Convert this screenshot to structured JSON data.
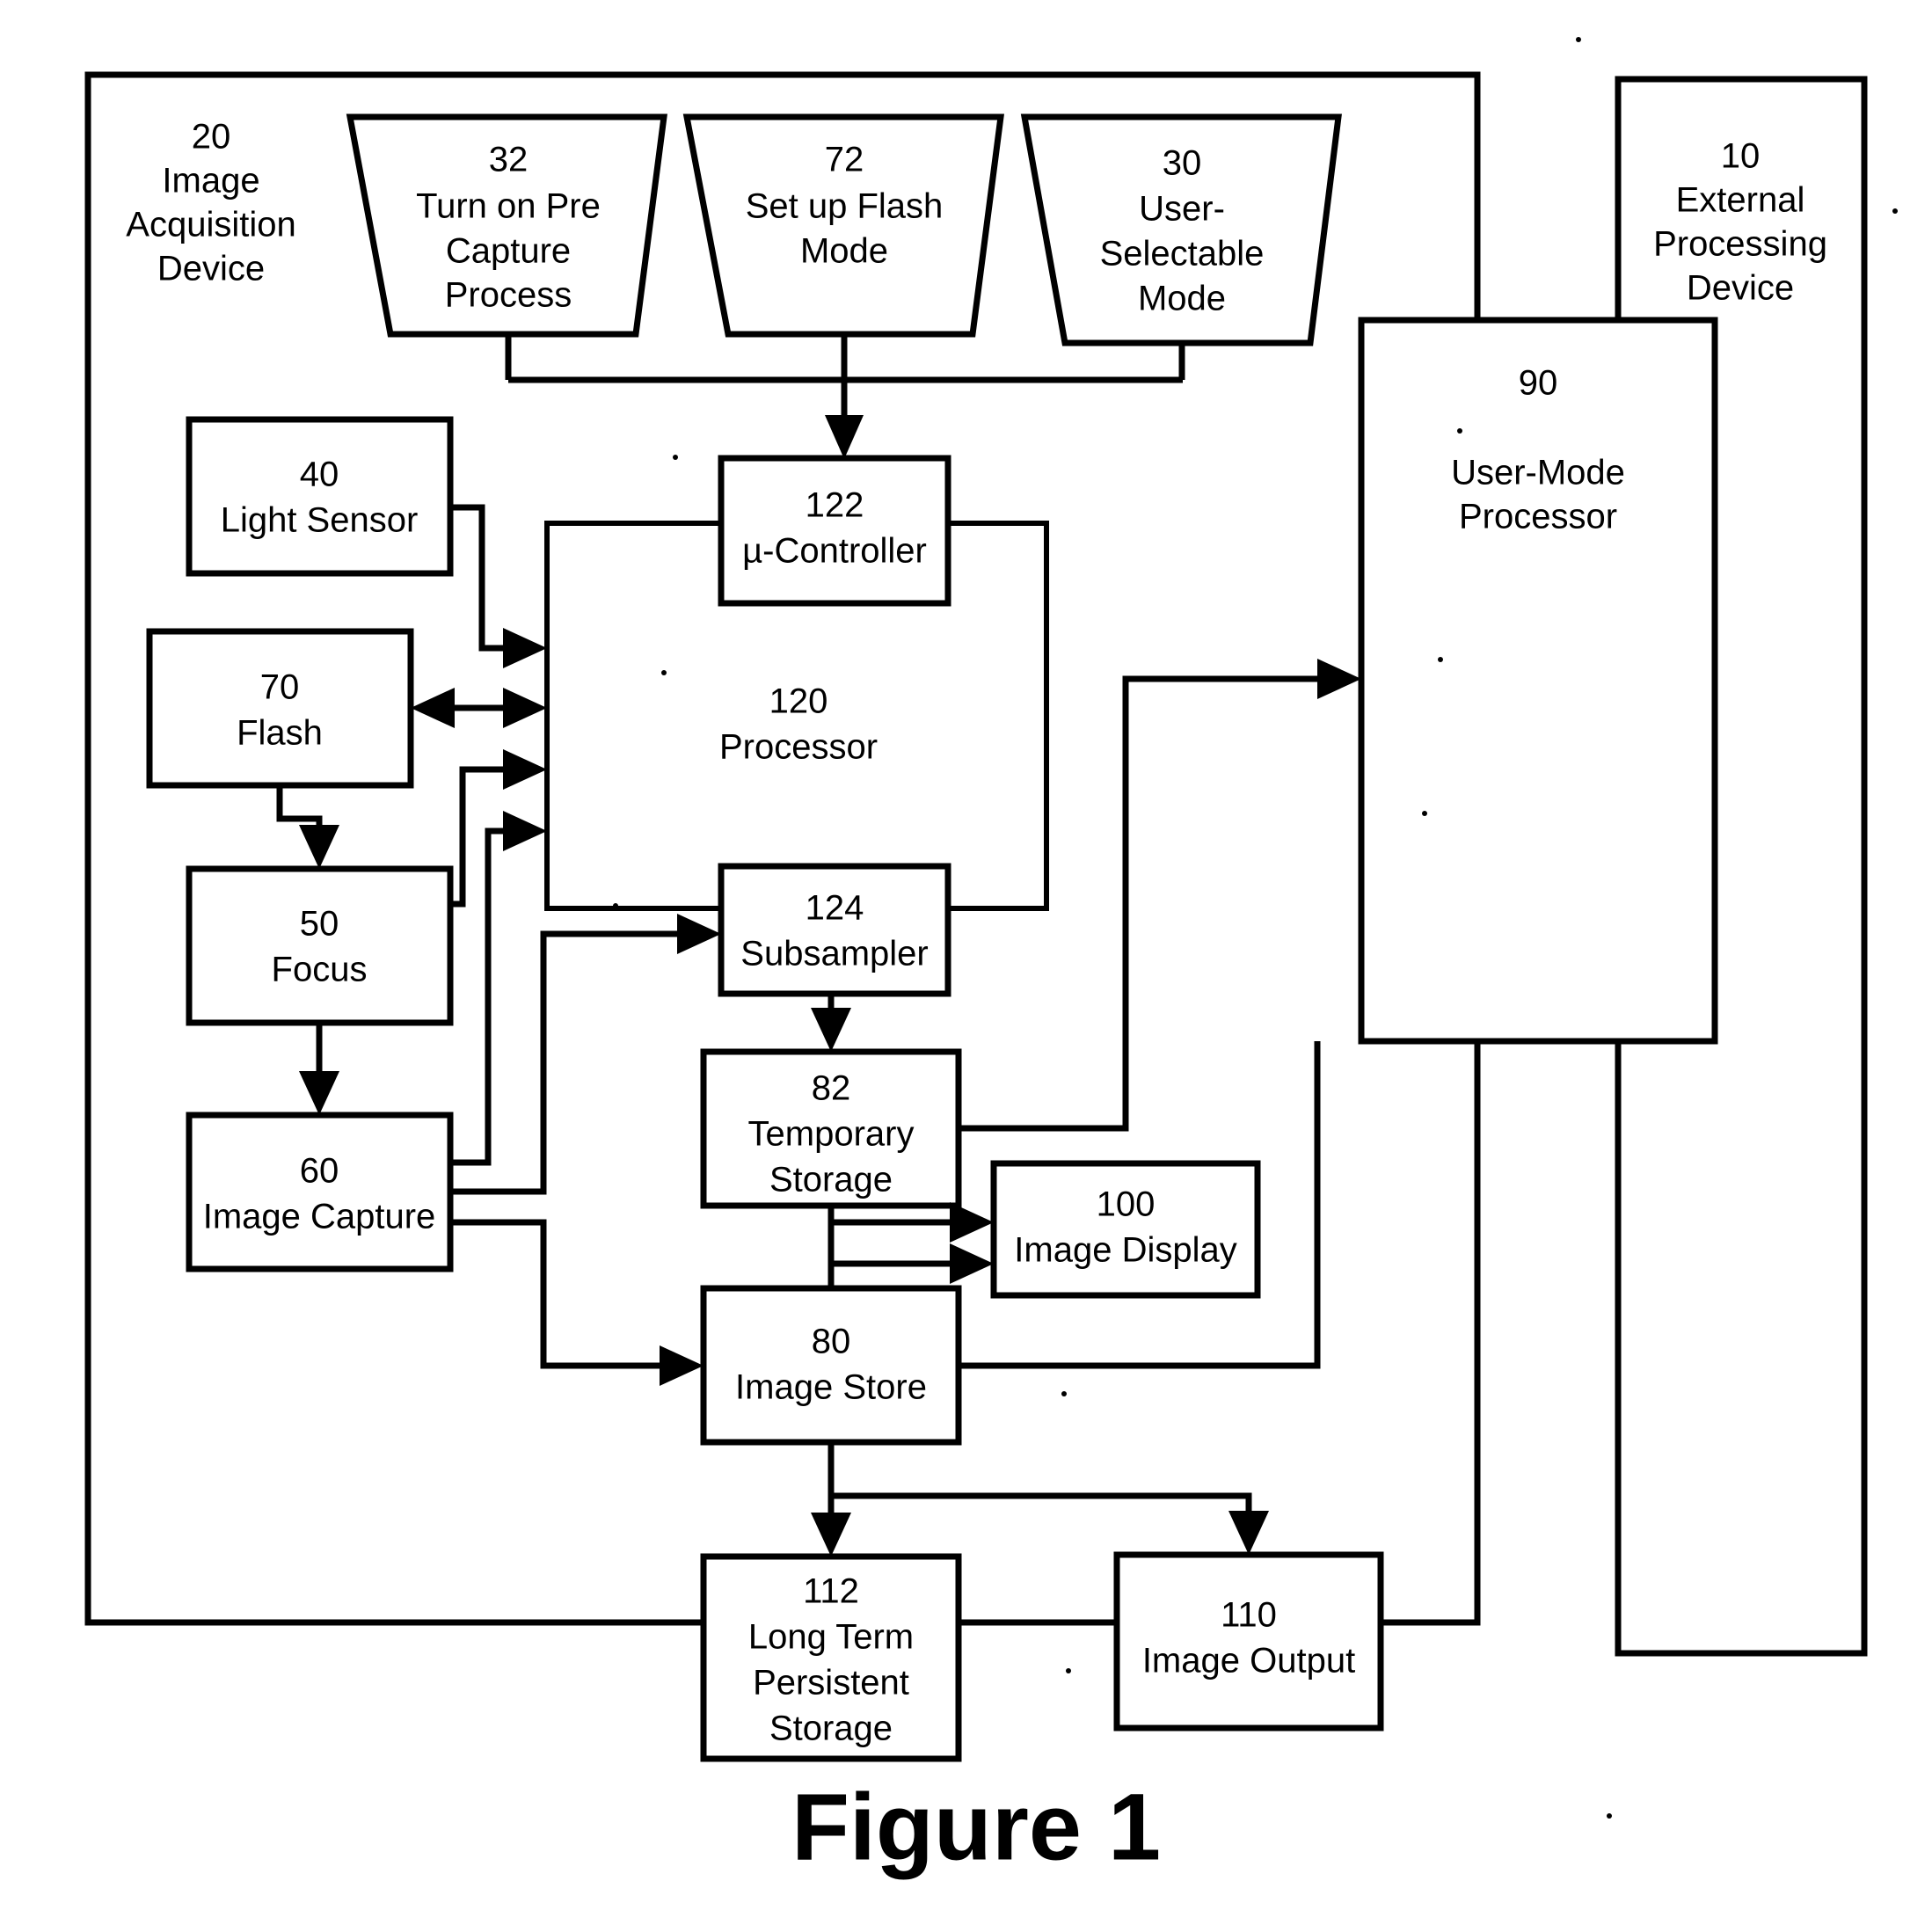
{
  "figure": {
    "caption": "Figure 1"
  },
  "containers": [
    {
      "id": "image-acquisition-device",
      "ref": "20",
      "name": "Image Acquisition Device",
      "lines": [
        "20",
        "Image",
        "Acquisition",
        "Device"
      ]
    },
    {
      "id": "external-processing-device",
      "ref": "10",
      "name": "External Processing Device",
      "lines": [
        "10",
        "External",
        "Processing",
        "Device"
      ]
    }
  ],
  "trapezoids": [
    {
      "id": "turn-on-pre-capture-process",
      "ref": "32",
      "lines": [
        "32",
        "Turn on Pre",
        "Capture",
        "Process"
      ]
    },
    {
      "id": "set-up-flash-mode",
      "ref": "72",
      "lines": [
        "72",
        "Set up Flash",
        "Mode"
      ]
    },
    {
      "id": "user-selectable-mode",
      "ref": "30",
      "lines": [
        "30",
        "User-",
        "Selectable",
        "Mode"
      ]
    }
  ],
  "blocks": [
    {
      "id": "light-sensor",
      "ref": "40",
      "lines": [
        "40",
        "Light Sensor"
      ]
    },
    {
      "id": "flash",
      "ref": "70",
      "lines": [
        "70",
        "Flash"
      ]
    },
    {
      "id": "focus",
      "ref": "50",
      "lines": [
        "50",
        "Focus"
      ]
    },
    {
      "id": "image-capture",
      "ref": "60",
      "lines": [
        "60",
        "Image Capture"
      ]
    },
    {
      "id": "processor",
      "ref": "120",
      "lines": [
        "120",
        "Processor"
      ]
    },
    {
      "id": "micro-controller",
      "ref": "122",
      "lines": [
        "122",
        "µ-Controller"
      ]
    },
    {
      "id": "subsampler",
      "ref": "124",
      "lines": [
        "124",
        "Subsampler"
      ]
    },
    {
      "id": "temporary-storage",
      "ref": "82",
      "lines": [
        "82",
        "Temporary",
        "Storage"
      ]
    },
    {
      "id": "image-display",
      "ref": "100",
      "lines": [
        "100",
        "Image Display"
      ]
    },
    {
      "id": "image-store",
      "ref": "80",
      "lines": [
        "80",
        "Image Store"
      ]
    },
    {
      "id": "long-term-persistent-storage",
      "ref": "112",
      "lines": [
        "112",
        "Long Term",
        "Persistent",
        "Storage"
      ]
    },
    {
      "id": "image-output",
      "ref": "110",
      "lines": [
        "110",
        "Image Output"
      ]
    },
    {
      "id": "user-mode-processor",
      "ref": "90",
      "lines": [
        "90",
        "User-Mode",
        "Processor"
      ]
    }
  ],
  "chart_data": {
    "type": "diagram",
    "title": "Figure 1",
    "nodes": [
      {
        "ref": "20",
        "label": "Image Acquisition Device",
        "shape": "container"
      },
      {
        "ref": "10",
        "label": "External Processing Device",
        "shape": "container"
      },
      {
        "ref": "32",
        "label": "Turn on Pre Capture Process",
        "shape": "trapezoid"
      },
      {
        "ref": "72",
        "label": "Set up Flash Mode",
        "shape": "trapezoid"
      },
      {
        "ref": "30",
        "label": "User-Selectable Mode",
        "shape": "trapezoid"
      },
      {
        "ref": "40",
        "label": "Light Sensor",
        "shape": "rect"
      },
      {
        "ref": "70",
        "label": "Flash",
        "shape": "rect"
      },
      {
        "ref": "50",
        "label": "Focus",
        "shape": "rect"
      },
      {
        "ref": "60",
        "label": "Image Capture",
        "shape": "rect"
      },
      {
        "ref": "120",
        "label": "Processor",
        "shape": "rect"
      },
      {
        "ref": "122",
        "label": "µ-Controller",
        "shape": "rect"
      },
      {
        "ref": "124",
        "label": "Subsampler",
        "shape": "rect"
      },
      {
        "ref": "82",
        "label": "Temporary Storage",
        "shape": "rect"
      },
      {
        "ref": "80",
        "label": "Image Store",
        "shape": "rect"
      },
      {
        "ref": "100",
        "label": "Image Display",
        "shape": "rect"
      },
      {
        "ref": "112",
        "label": "Long Term Persistent Storage",
        "shape": "rect"
      },
      {
        "ref": "110",
        "label": "Image Output",
        "shape": "rect"
      },
      {
        "ref": "90",
        "label": "User-Mode Processor",
        "shape": "rect"
      }
    ],
    "edges": [
      {
        "from": "32",
        "to": "122",
        "arrow": true
      },
      {
        "from": "72",
        "to": "122",
        "arrow": true
      },
      {
        "from": "30",
        "to": "122",
        "arrow": true
      },
      {
        "from": "40",
        "to": "120",
        "arrow": true
      },
      {
        "from": "70",
        "to": "120",
        "arrow": "both"
      },
      {
        "from": "70",
        "to": "50",
        "arrow": true
      },
      {
        "from": "50",
        "to": "120",
        "arrow": true
      },
      {
        "from": "50",
        "to": "60",
        "arrow": true
      },
      {
        "from": "60",
        "to": "120",
        "arrow": true
      },
      {
        "from": "60",
        "to": "124",
        "arrow": true
      },
      {
        "from": "60",
        "to": "80",
        "arrow": true
      },
      {
        "from": "124",
        "to": "82",
        "arrow": true
      },
      {
        "from": "82",
        "to": "100",
        "arrow": true
      },
      {
        "from": "80",
        "to": "100",
        "arrow": true
      },
      {
        "from": "82",
        "to": "90",
        "arrow": true
      },
      {
        "from": "80",
        "to": "112",
        "arrow": true
      },
      {
        "from": "80",
        "to": "110",
        "arrow": true
      },
      {
        "from": "112",
        "to": "110",
        "arrow": false
      },
      {
        "from": "110",
        "to": "10",
        "arrow": false
      }
    ]
  }
}
